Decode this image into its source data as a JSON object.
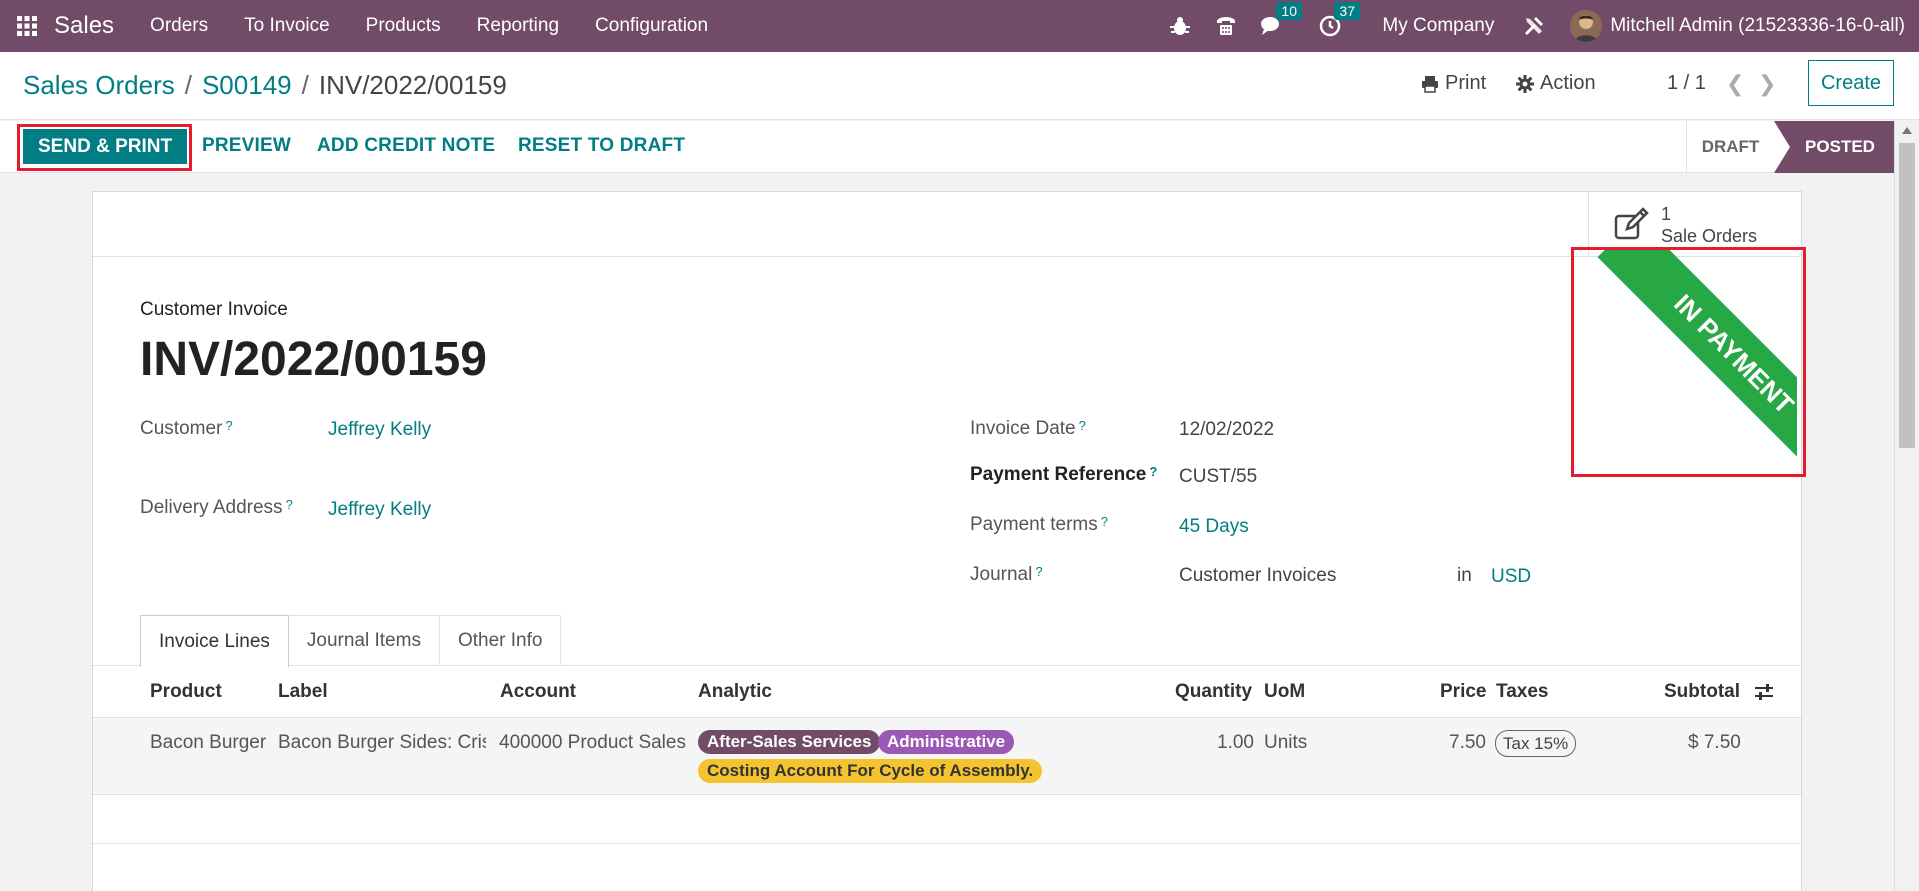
{
  "navbar": {
    "app_name": "Sales",
    "menu": [
      "Orders",
      "To Invoice",
      "Products",
      "Reporting",
      "Configuration"
    ],
    "chat_badge": "10",
    "activity_badge": "37",
    "company": "My Company",
    "user": "Mitchell Admin (21523336-16-0-all)"
  },
  "breadcrumb": {
    "root": "Sales Orders",
    "order": "S00149",
    "current": "INV/2022/00159"
  },
  "control": {
    "print": "Print",
    "action": "Action",
    "pager": "1 / 1",
    "create": "Create"
  },
  "statusbar": {
    "send_print": "SEND & PRINT",
    "preview": "PREVIEW",
    "add_credit_note": "ADD CREDIT NOTE",
    "reset_to_draft": "RESET TO DRAFT",
    "stage_draft": "DRAFT",
    "stage_posted": "POSTED"
  },
  "smart_button": {
    "count": "1",
    "label": "Sale Orders"
  },
  "ribbon": "IN PAYMENT",
  "form": {
    "doc_type": "Customer Invoice",
    "title": "INV/2022/00159",
    "customer_label": "Customer",
    "customer": "Jeffrey Kelly",
    "delivery_label": "Delivery Address",
    "delivery": "Jeffrey Kelly",
    "invoice_date_label": "Invoice Date",
    "invoice_date": "12/02/2022",
    "payment_ref_label": "Payment Reference",
    "payment_ref": "CUST/55",
    "payment_terms_label": "Payment terms",
    "payment_terms": "45 Days",
    "journal_label": "Journal",
    "journal": "Customer Invoices",
    "in_label": "in",
    "currency": "USD",
    "help_mark": "?"
  },
  "tabs": [
    "Invoice Lines",
    "Journal Items",
    "Other Info"
  ],
  "table": {
    "headers": {
      "product": "Product",
      "label": "Label",
      "account": "Account",
      "analytic": "Analytic",
      "quantity": "Quantity",
      "uom": "UoM",
      "price": "Price",
      "taxes": "Taxes",
      "subtotal": "Subtotal"
    },
    "rows": [
      {
        "product": "Bacon Burger",
        "label": "Bacon Burger Sides: Cris",
        "account": "400000 Product Sales",
        "tags": [
          "After-Sales Services",
          "Administrative",
          "Costing Account For Cycle of Assembly."
        ],
        "quantity": "1.00",
        "uom": "Units",
        "price": "7.50",
        "tax": "Tax 15%",
        "subtotal": "$ 7.50"
      }
    ]
  },
  "colors": {
    "brand": "#714b67",
    "accent": "#017e84",
    "ribbon": "#28a745",
    "highlight": "#e31d2f",
    "tag_after_sales": "#714b67",
    "tag_administrative": "#9b59b6",
    "tag_costing": "#f4c430"
  }
}
